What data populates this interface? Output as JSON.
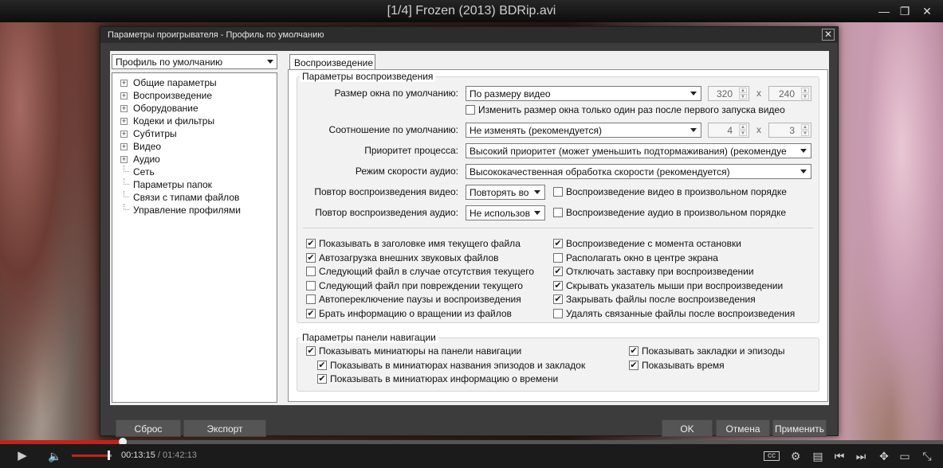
{
  "window": {
    "title": "[1/4] Frozen (2013) BDRip.avi"
  },
  "dialog": {
    "title": "Параметры проигрывателя - Профиль по умолчанию",
    "profile": "Профиль по умолчанию",
    "tree": [
      "Общие параметры",
      "Воспроизведение",
      "Оборудование",
      "Кодеки и фильтры",
      "Субтитры",
      "Видео",
      "Аудио",
      "Сеть",
      "Параметры папок",
      "Связи с типами файлов",
      "Управление профилями"
    ],
    "tab": "Воспроизведение",
    "playback": {
      "legend": "Параметры воспроизведения",
      "window_size_label": "Размер окна по умолчанию:",
      "window_size_value": "По размеру видео",
      "w": "320",
      "h": "240",
      "x": "x",
      "resize_once": "Изменить размер окна только один раз после первого запуска видео",
      "ratio_label": "Соотношение по умолчанию:",
      "ratio_value": "Не изменять (рекомендуется)",
      "ratio_w": "4",
      "ratio_h": "3",
      "priority_label": "Приоритет процесса:",
      "priority_value": "Высокий приоритет (может уменьшить подтормаживания) (рекомендуе",
      "audio_speed_label": "Режим скорости аудио:",
      "audio_speed_value": "Высококачественная обработка скорости (рекомендуется)",
      "repeat_video_label": "Повтор воспроизведения видео:",
      "repeat_video_value": "Повторять во",
      "shuffle_video": "Воспроизведение видео в произвольном порядке",
      "repeat_audio_label": "Повтор воспроизведения аудио:",
      "repeat_audio_value": "Не использов",
      "shuffle_audio": "Воспроизведение аудио в произвольном порядке"
    },
    "checks_left": [
      {
        "label": "Показывать в заголовке имя текущего файла",
        "checked": true
      },
      {
        "label": "Автозагрузка внешних звуковых файлов",
        "checked": true
      },
      {
        "label": "Следующий файл в случае отсутствия текущего",
        "checked": false
      },
      {
        "label": "Следующий файл при повреждении текущего",
        "checked": false
      },
      {
        "label": "Автопереключение паузы и воспроизведения",
        "checked": false
      },
      {
        "label": "Брать информацию о вращении из файлов",
        "checked": true
      }
    ],
    "checks_right": [
      {
        "label": "Воспроизведение с момента остановки",
        "checked": true
      },
      {
        "label": "Располагать окно в центре экрана",
        "checked": false
      },
      {
        "label": "Отключать заставку при воспроизведении",
        "checked": true
      },
      {
        "label": "Скрывать указатель мыши при воспроизведении",
        "checked": true
      },
      {
        "label": "Закрывать файлы после воспроизведения",
        "checked": true
      },
      {
        "label": "Удалять связанные файлы после воспроизведения",
        "checked": false
      }
    ],
    "nav": {
      "legend": "Параметры панели навигации",
      "show_thumbs": "Показывать миниатюры на панели навигации",
      "thumb_names": "Показывать в миниатюрах названия эпизодов и закладок",
      "thumb_time": "Показывать в миниатюрах информацию о времени",
      "show_bookmarks": "Показывать закладки и эпизоды",
      "show_time": "Показывать время"
    },
    "buttons": {
      "reset": "Сброс",
      "export": "Экспорт",
      "ok": "OK",
      "cancel": "Отмена",
      "apply": "Применить"
    }
  },
  "player": {
    "current": "00:13:15",
    "sep": " / ",
    "duration": "01:42:13",
    "progress": 0.13,
    "volume": 0.92,
    "accent": "#c4221a"
  }
}
